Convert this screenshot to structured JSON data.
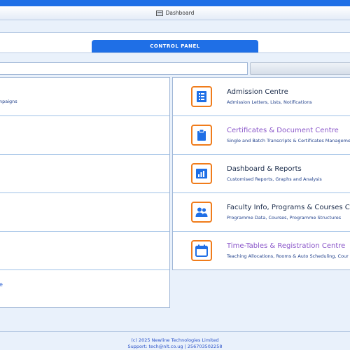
{
  "header": {
    "breadcrumb_label": "Dashboard"
  },
  "control_panel": {
    "tab_label": "CONTROL PANEL"
  },
  "left_panel": {
    "row1_subtitle": "npaigns",
    "link_text": "e"
  },
  "tiles": [
    {
      "title": "Admission Centre",
      "subtitle": "Admission Letters, Lists, Notifications",
      "icon": "document-list-icon",
      "visited": false
    },
    {
      "title": "Certificates & Document Centre",
      "subtitle": "Single and Batch Transcripts & Certificates Manageme",
      "icon": "clipboard-icon",
      "visited": true
    },
    {
      "title": "Dashboard & Reports",
      "subtitle": "Customised Reports, Graphs and Analysis",
      "icon": "bar-chart-icon",
      "visited": false
    },
    {
      "title": "Faculty Info, Programs & Courses Ce",
      "subtitle": "Programme Data, Courses, Programme Structures",
      "icon": "users-icon",
      "visited": false
    },
    {
      "title": "Time-Tables & Registration Centre",
      "subtitle": "Teaching Allocations, Rooms & Auto Scheduling, Cour",
      "icon": "calendar-icon",
      "visited": true
    }
  ],
  "footer": {
    "copyright": "(c) 2025 Newline Technologies Limited",
    "support": "Support: tech@nlt.co.ug | 256703502258"
  },
  "colors": {
    "accent": "#1f6fe6",
    "icon_border": "#f07c1b",
    "icon_fill": "#1f6fe6",
    "visited_link": "#8a56c9"
  }
}
